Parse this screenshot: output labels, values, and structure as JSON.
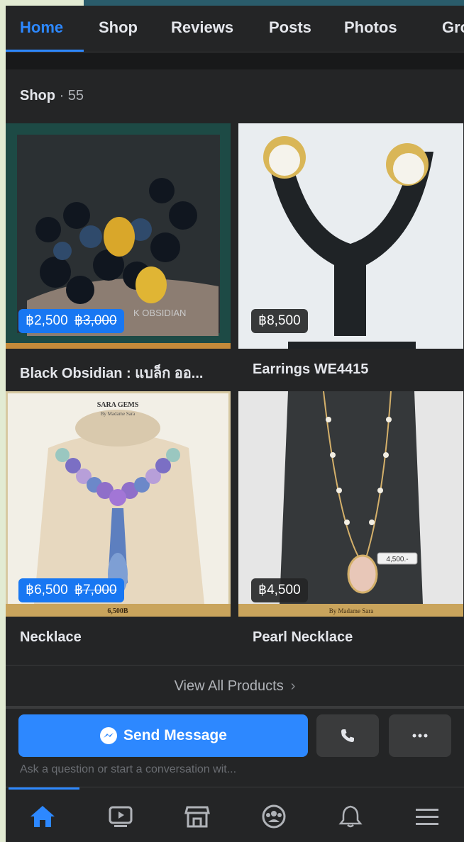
{
  "tabs": [
    "Home",
    "Shop",
    "Reviews",
    "Posts",
    "Photos",
    "Gro"
  ],
  "shop": {
    "title": "Shop",
    "count": "· 55"
  },
  "products": [
    {
      "name": "Black Obsidian : แบล็ก ออ...",
      "price": "฿2,500",
      "old_price": "฿3,000",
      "image_text": "K OBSIDIAN"
    },
    {
      "name": "Earrings WE4415",
      "price": "฿8,500",
      "old_price": ""
    },
    {
      "name": "Necklace",
      "price": "฿6,500",
      "old_price": "฿7,000",
      "image_text": "SARA GEMS",
      "image_subtext": "By Madame Sara",
      "image_caption": "6,500B"
    },
    {
      "name": "Pearl Necklace",
      "price": "฿4,500",
      "old_price": "",
      "image_tag": "4,500.-",
      "image_caption": "By Madame Sara"
    }
  ],
  "view_all": "View All Products",
  "send_message": "Send Message",
  "hint": "Ask a question or start a conversation wit...",
  "bottom_nav": [
    "home-icon",
    "video-icon",
    "marketplace-icon",
    "groups-icon",
    "bell-icon",
    "menu-icon"
  ],
  "colors": {
    "accent": "#2d88ff",
    "bg": "#242526",
    "badge_blue": "#1877f2"
  }
}
